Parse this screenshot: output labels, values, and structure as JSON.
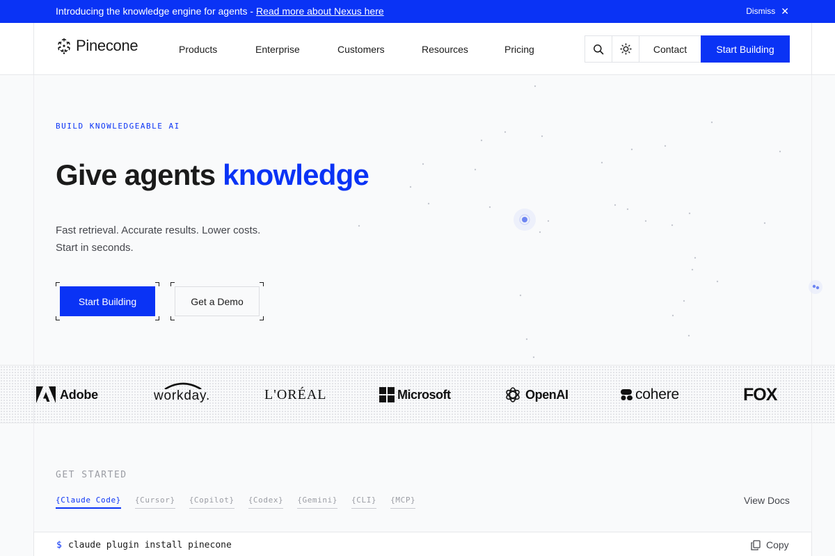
{
  "announcement": {
    "text": "Introducing the knowledge engine for agents - ",
    "link": "Read more about Nexus here",
    "dismiss": "Dismiss"
  },
  "header": {
    "brand": "Pinecone",
    "nav": [
      "Products",
      "Enterprise",
      "Customers",
      "Resources",
      "Pricing"
    ],
    "contact": "Contact",
    "cta": "Start Building",
    "icons": [
      "search-icon",
      "theme-toggle-icon"
    ]
  },
  "hero": {
    "eyebrow": "BUILD KNOWLEDGEABLE AI",
    "headline_plain": "Give agents ",
    "headline_accent": "knowledge",
    "subtitle_line1": "Fast retrieval. Accurate results. Lower costs.",
    "subtitle_line2": "Start in seconds.",
    "primary_button": "Start Building",
    "secondary_button": "Get a Demo"
  },
  "logos": [
    "Adobe",
    "workday.",
    "L'ORÉAL",
    "Microsoft",
    "OpenAI",
    "cohere",
    "FOX"
  ],
  "get_started": {
    "title": "GET STARTED",
    "tabs": [
      "{Claude Code}",
      "{Cursor}",
      "{Copilot}",
      "{Codex}",
      "{Gemini}",
      "{CLI}",
      "{MCP}"
    ],
    "active_tab": "{Claude Code}",
    "view_docs": "View Docs",
    "prompt": "$",
    "command": "claude plugin install pinecone",
    "copy": "Copy"
  },
  "colors": {
    "accent": "#0a33f5",
    "text": "#1b1b1b",
    "muted": "#9a9ca3",
    "background": "#f9fafb"
  }
}
